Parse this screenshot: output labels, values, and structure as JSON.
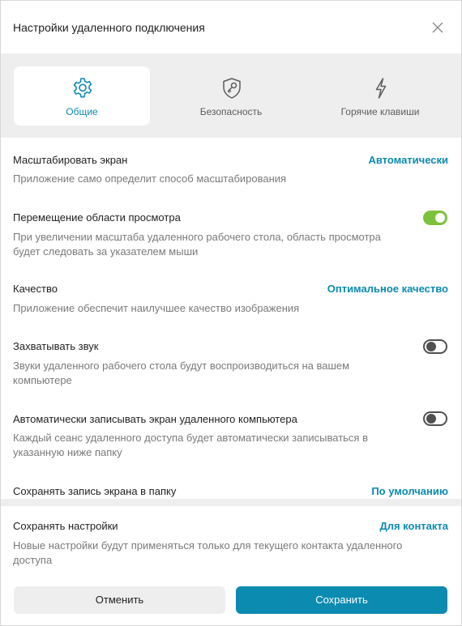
{
  "dialog": {
    "title": "Настройки удаленного подключения",
    "close_icon": "close-icon"
  },
  "tabs": [
    {
      "label": "Общие",
      "icon": "gear-icon",
      "active": true
    },
    {
      "label": "Безопасность",
      "icon": "shield-key-icon",
      "active": false
    },
    {
      "label": "Горячие клавиши",
      "icon": "lightning-icon",
      "active": false
    }
  ],
  "settings": {
    "scale": {
      "title": "Масштабировать экран",
      "value": "Автоматически",
      "description": "Приложение само определит способ масштабирования"
    },
    "viewport_move": {
      "title": "Перемещение области просмотра",
      "enabled": true,
      "description_line1": "При увеличении масштаба удаленного рабочего стола, область просмотра",
      "description_line2": "будет следовать за указателем мыши"
    },
    "quality": {
      "title": "Качество",
      "value": "Оптимальное качество",
      "description": "Приложение обеспечит наилучшее качество изображения"
    },
    "capture_sound": {
      "title": "Захватывать звук",
      "enabled": false,
      "description_line1": "Звуки удаленного рабочего стола будут воспроизводиться на вашем",
      "description_line2": "компьютере"
    },
    "auto_record": {
      "title": "Автоматически записывать экран удаленного компьютера",
      "enabled": false,
      "description_line1": "Каждый сеанс удаленного доступа будет автоматически записываться в",
      "description_line2": "указанную ниже папку"
    },
    "record_folder": {
      "title": "Сохранять запись экрана в папку",
      "value": "По умолчанию"
    }
  },
  "save_settings": {
    "title": "Сохранять настройки",
    "value": "Для контакта",
    "description_line1": "Новые настройки будут применяться только для текущего контакта удаленного",
    "description_line2": "доступа"
  },
  "buttons": {
    "cancel": "Отменить",
    "save": "Сохранить"
  },
  "colors": {
    "accent": "#0b8bb0",
    "toggle_on": "#7cc13b",
    "panel_bg": "#eeeeee"
  }
}
